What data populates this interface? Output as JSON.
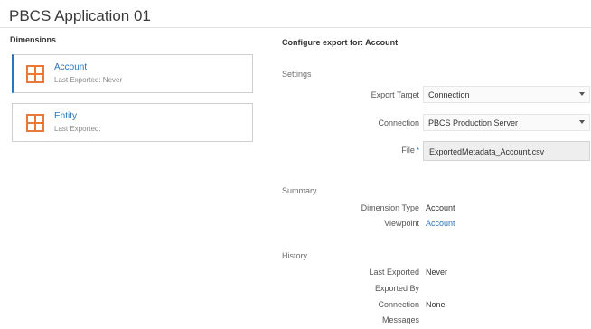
{
  "app": {
    "title": "PBCS Application 01"
  },
  "dimensions": {
    "heading": "Dimensions",
    "items": [
      {
        "name": "Account",
        "last_exported": "Last Exported: Never",
        "selected": true
      },
      {
        "name": "Entity",
        "last_exported": "Last Exported:",
        "selected": false
      }
    ]
  },
  "config": {
    "heading": "Configure export for: Account",
    "settings": {
      "title": "Settings",
      "export_target_label": "Export Target",
      "export_target_value": "Connection",
      "connection_label": "Connection",
      "connection_value": "PBCS Production Server",
      "file_label": "File",
      "file_required_marker": "*",
      "file_value": "ExportedMetadata_Account.csv"
    },
    "summary": {
      "title": "Summary",
      "dimension_type_label": "Dimension Type",
      "dimension_type_value": "Account",
      "viewpoint_label": "Viewpoint",
      "viewpoint_value": "Account"
    },
    "history": {
      "title": "History",
      "last_exported_label": "Last Exported",
      "last_exported_value": "Never",
      "exported_by_label": "Exported By",
      "connection_label": "Connection",
      "connection_value": "None",
      "messages_label": "Messages"
    }
  },
  "colors": {
    "accent": "#2a74b9",
    "icon": "#e8793a"
  },
  "icons": {
    "dimension": "grid-icon",
    "dropdown": "caret-down-icon"
  }
}
